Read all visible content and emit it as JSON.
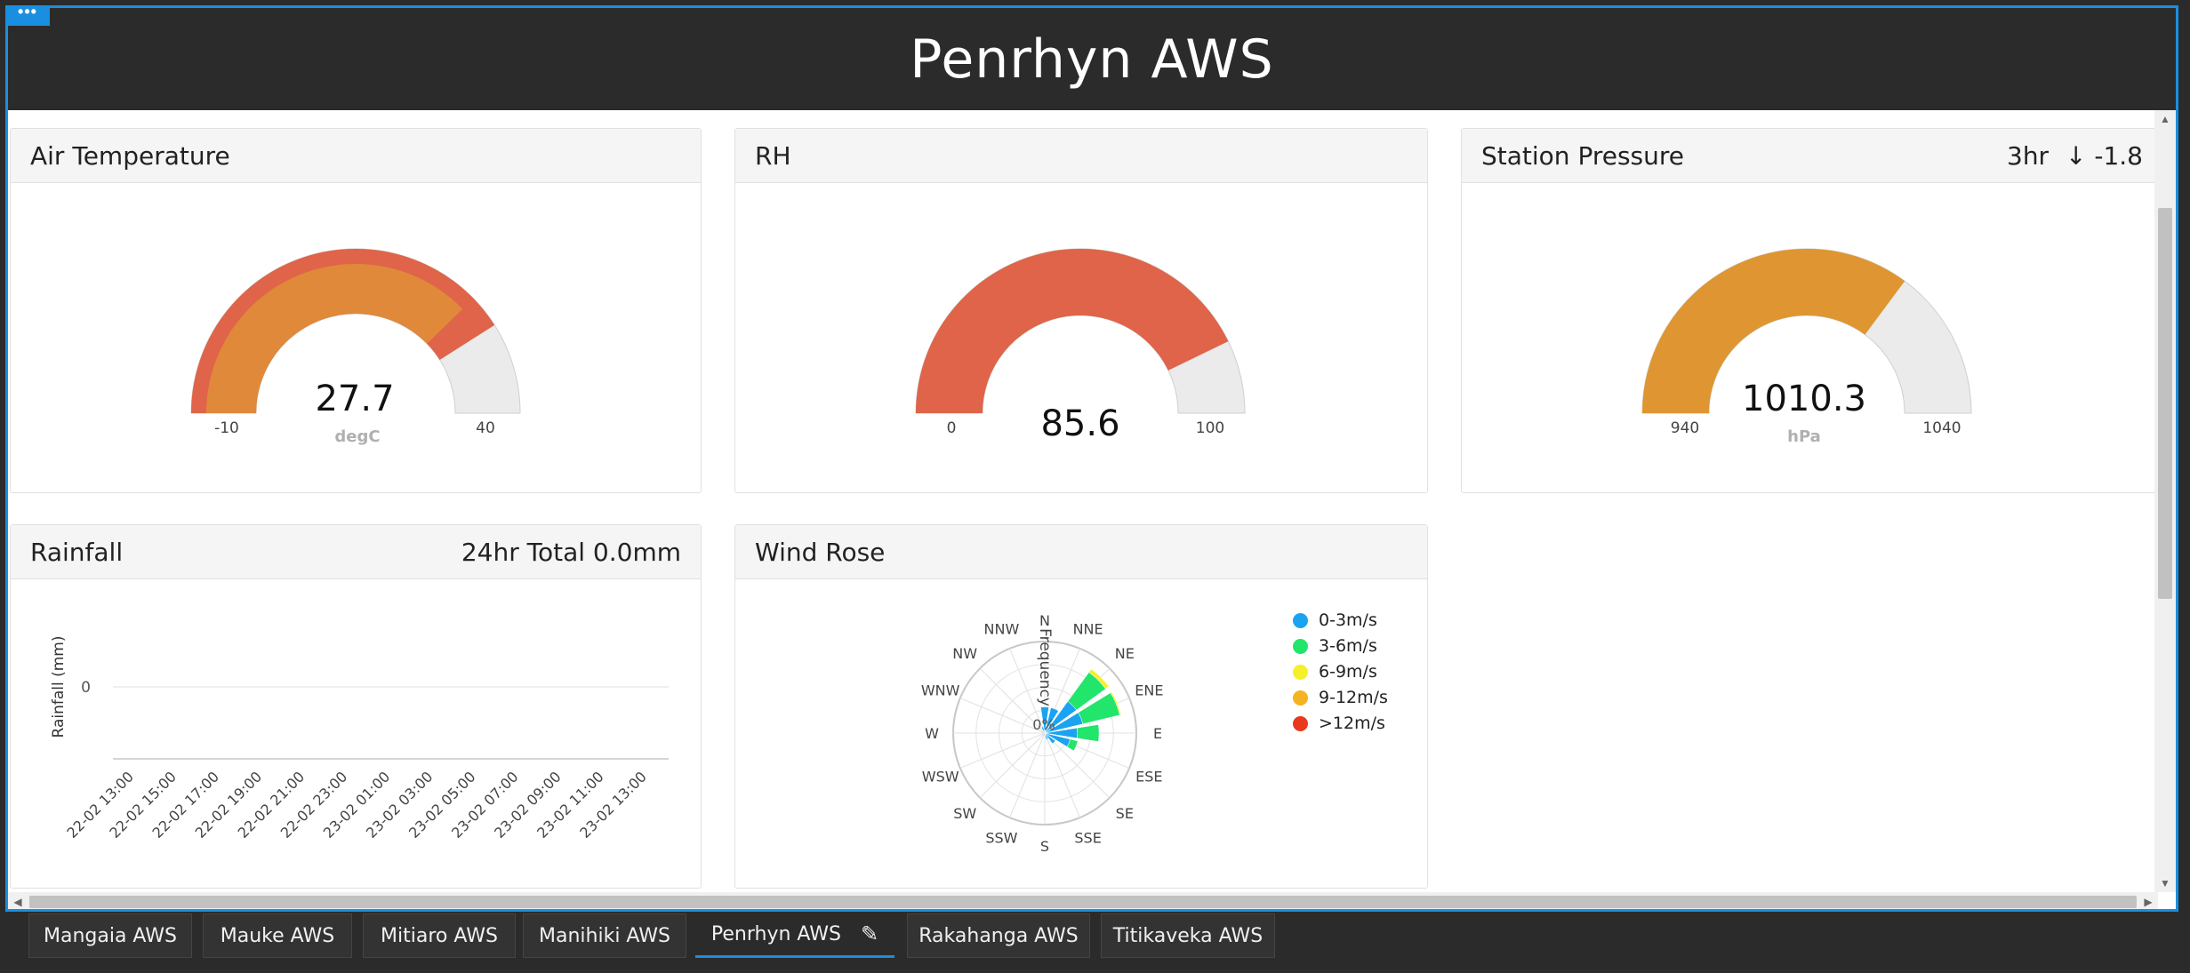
{
  "page_title": "Penrhyn AWS",
  "menu_handle": "•••",
  "cards": {
    "air_temperature": {
      "title": "Air Temperature",
      "value": "27.7",
      "unit": "degC",
      "min": "-10",
      "max": "40",
      "gauge": {
        "min": -10,
        "max": 40,
        "value": 27.7,
        "outer_value": 31.0,
        "band_value": 25.5
      }
    },
    "rh": {
      "title": "RH",
      "value": "85.6",
      "min": "0",
      "max": "100",
      "gauge": {
        "min": 0,
        "max": 100,
        "value": 85.6
      }
    },
    "station_pressure": {
      "title": "Station Pressure",
      "trend_label": "3hr",
      "trend_arrow": "↓",
      "trend_value": "-1.8",
      "value": "1010.3",
      "unit": "hPa",
      "min": "940",
      "max": "1040",
      "gauge": {
        "min": 940,
        "max": 1040,
        "value": 1010.3
      }
    },
    "rainfall": {
      "title": "Rainfall",
      "total_label": "24hr Total 0.0mm"
    },
    "wind_rose": {
      "title": "Wind Rose"
    }
  },
  "chart_data": [
    {
      "type": "bar",
      "ylabel": "Rainfall (mm)",
      "yticks": [
        "0"
      ],
      "categories": [
        "22-02 13:00",
        "22-02 15:00",
        "22-02 17:00",
        "22-02 19:00",
        "22-02 21:00",
        "22-02 23:00",
        "23-02 01:00",
        "23-02 03:00",
        "23-02 05:00",
        "23-02 07:00",
        "23-02 09:00",
        "23-02 11:00",
        "23-02 13:00"
      ],
      "values": [
        0,
        0,
        0,
        0,
        0,
        0,
        0,
        0,
        0,
        0,
        0,
        0,
        0
      ]
    },
    {
      "type": "wind-rose",
      "axis_label": "Frequency",
      "radial_tick": "0%",
      "directions": [
        "N",
        "NNE",
        "NE",
        "ENE",
        "E",
        "ESE",
        "SE",
        "SSE",
        "S",
        "SSW",
        "SW",
        "WSW",
        "W",
        "WNW",
        "NW",
        "NNW"
      ],
      "legend": [
        "0-3m/s",
        "3-6m/s",
        "6-9m/s",
        "9-12m/s",
        ">12m/s"
      ],
      "legend_colors": [
        "#1aa3f0",
        "#22e56b",
        "#f5f02a",
        "#f5b322",
        "#e8391f"
      ],
      "series": [
        {
          "name": "0-3m/s",
          "values": [
            0.4,
            0.4,
            0.6,
            0.6,
            0.5,
            0.4,
            0.2,
            0.1,
            0,
            0,
            0,
            0,
            0,
            0,
            0,
            0.1
          ]
        },
        {
          "name": "3-6m/s",
          "values": [
            0,
            0,
            0.55,
            0.58,
            0.33,
            0.12,
            0,
            0,
            0,
            0,
            0,
            0,
            0,
            0,
            0,
            0
          ]
        },
        {
          "name": "6-9m/s",
          "values": [
            0,
            0,
            0.06,
            0.02,
            0,
            0,
            0,
            0,
            0,
            0,
            0,
            0,
            0,
            0,
            0,
            0
          ]
        },
        {
          "name": "9-12m/s",
          "values": [
            0,
            0,
            0,
            0,
            0,
            0,
            0,
            0,
            0,
            0,
            0,
            0,
            0,
            0,
            0,
            0
          ]
        },
        {
          "name": ">12m/s",
          "values": [
            0,
            0,
            0,
            0,
            0,
            0,
            0,
            0,
            0,
            0,
            0,
            0,
            0,
            0,
            0,
            0
          ]
        }
      ]
    }
  ],
  "tabs": [
    {
      "label": "Mangaia AWS",
      "active": false
    },
    {
      "label": "Mauke AWS",
      "active": false
    },
    {
      "label": "Mitiaro AWS",
      "active": false
    },
    {
      "label": "Manihiki AWS",
      "active": false
    },
    {
      "label": "Penrhyn AWS",
      "active": true
    },
    {
      "label": "Rakahanga AWS",
      "active": false
    },
    {
      "label": "Titikaveka AWS",
      "active": false
    }
  ],
  "colors": {
    "temp_outer": "#df6449",
    "temp_inner": "#e0893a",
    "rh_fill": "#df6449",
    "pressure_fill": "#df9632",
    "gauge_track": "#ebebeb",
    "accent": "#1a8fe0"
  }
}
